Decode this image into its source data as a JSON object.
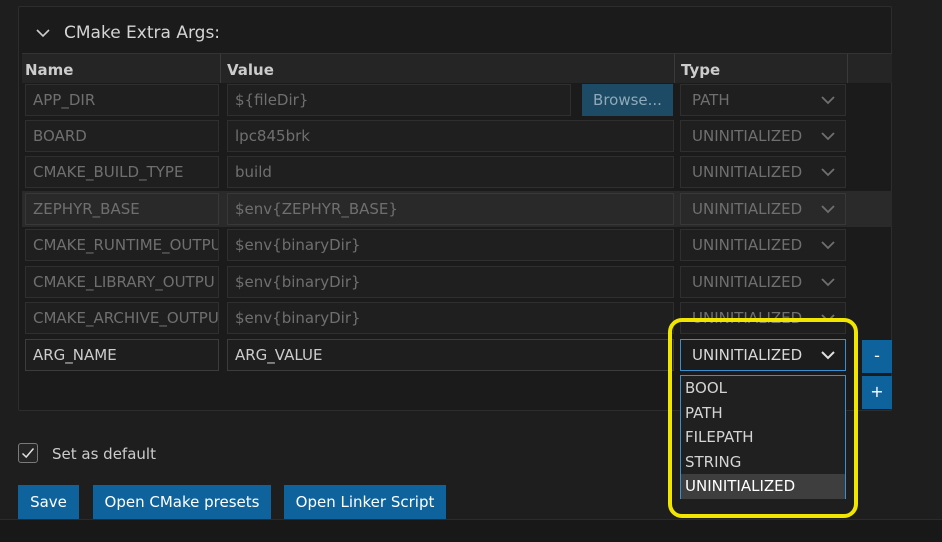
{
  "section": {
    "title": "CMake Extra Args:"
  },
  "table": {
    "headers": {
      "name": "Name",
      "value": "Value",
      "type": "Type"
    },
    "browse_label": "Browse...",
    "rows": [
      {
        "name": "APP_DIR",
        "value": "${fileDir}",
        "type": "PATH"
      },
      {
        "name": "BOARD",
        "value": "lpc845brk",
        "type": "UNINITIALIZED"
      },
      {
        "name": "CMAKE_BUILD_TYPE",
        "value": "build",
        "type": "UNINITIALIZED"
      },
      {
        "name": "ZEPHYR_BASE",
        "value": "$env{ZEPHYR_BASE}",
        "type": "UNINITIALIZED"
      },
      {
        "name": "CMAKE_RUNTIME_OUTPU",
        "value": "$env{binaryDir}",
        "type": "UNINITIALIZED"
      },
      {
        "name": "CMAKE_LIBRARY_OUTPU",
        "value": "$env{binaryDir}",
        "type": "UNINITIALIZED"
      },
      {
        "name": "CMAKE_ARCHIVE_OUTPU",
        "value": "$env{binaryDir}",
        "type": "UNINITIALIZED"
      },
      {
        "name": "ARG_NAME",
        "value": "ARG_VALUE",
        "type": "UNINITIALIZED"
      }
    ],
    "remove_label": "-",
    "add_label": "+"
  },
  "type_dropdown": {
    "options": [
      "BOOL",
      "PATH",
      "FILEPATH",
      "STRING",
      "UNINITIALIZED"
    ],
    "selected": "UNINITIALIZED"
  },
  "default_checkbox": {
    "label": "Set as default",
    "checked": true
  },
  "buttons": {
    "save": "Save",
    "open_presets": "Open CMake presets",
    "open_linker": "Open Linker Script"
  },
  "colors": {
    "accent": "#0e639c",
    "highlight": "#f0e600",
    "focus_border": "#3a8fd0"
  }
}
